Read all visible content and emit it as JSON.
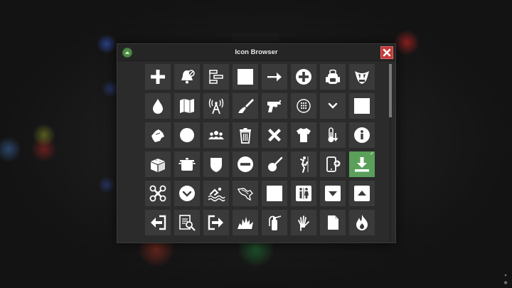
{
  "dialog": {
    "title": "Icon Browser",
    "logo_icon": "game-logo-icon",
    "close_icon": "close-icon",
    "accent_close": "#c43a3a",
    "accent_selected": "#5aa05a"
  },
  "icons": [
    {
      "name": "plus-icon"
    },
    {
      "name": "bell-slash-icon"
    },
    {
      "name": "timeline-icon"
    },
    {
      "name": "square-icon"
    },
    {
      "name": "arrow-right-icon"
    },
    {
      "name": "plus-circle-icon"
    },
    {
      "name": "backpack-icon"
    },
    {
      "name": "fangs-icon"
    },
    {
      "name": "water-drop-icon"
    },
    {
      "name": "map-icon"
    },
    {
      "name": "radio-tower-icon"
    },
    {
      "name": "brush-icon"
    },
    {
      "name": "revolver-icon"
    },
    {
      "name": "dial-pad-icon"
    },
    {
      "name": "chevron-down-icon"
    },
    {
      "name": "square-icon"
    },
    {
      "name": "hand-icon"
    },
    {
      "name": "circle-icon"
    },
    {
      "name": "users-icon"
    },
    {
      "name": "trash-icon"
    },
    {
      "name": "x-mark-icon"
    },
    {
      "name": "shirt-icon"
    },
    {
      "name": "temperature-down-icon"
    },
    {
      "name": "info-circle-icon"
    },
    {
      "name": "brick-icon"
    },
    {
      "name": "cooking-pot-icon"
    },
    {
      "name": "shield-icon"
    },
    {
      "name": "minus-circle-icon"
    },
    {
      "name": "frying-pan-icon"
    },
    {
      "name": "climber-icon"
    },
    {
      "name": "tablet-add-icon"
    },
    {
      "name": "download-icon",
      "selected": true,
      "check": "✓"
    },
    {
      "name": "drone-icon"
    },
    {
      "name": "chevron-down-circle-icon"
    },
    {
      "name": "swimmer-icon"
    },
    {
      "name": "region-map-icon"
    },
    {
      "name": "square-icon"
    },
    {
      "name": "restroom-icon"
    },
    {
      "name": "caret-down-box-icon"
    },
    {
      "name": "caret-up-box-icon"
    },
    {
      "name": "sign-out-icon"
    },
    {
      "name": "document-search-icon"
    },
    {
      "name": "exit-arrow-icon"
    },
    {
      "name": "explosion-icon"
    },
    {
      "name": "fire-extinguisher-icon"
    },
    {
      "name": "skeleton-hand-icon"
    },
    {
      "name": "file-icon"
    },
    {
      "name": "fire-icon"
    }
  ],
  "scroll": {
    "position_fraction": 0.0,
    "visible_fraction": 0.3
  }
}
